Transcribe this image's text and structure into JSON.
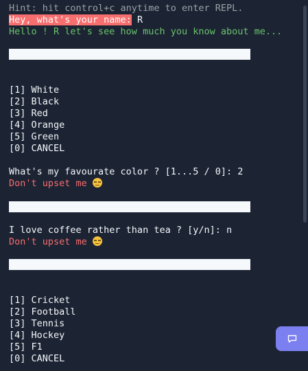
{
  "console": {
    "hint": "Hint: hit control+c anytime to enter REPL.",
    "name_prompt": "Hey, what's your name:",
    "name_value": " R",
    "greeting": "Hello ! R let's see how much you know about me...",
    "color_options": [
      "[1] White",
      "[2] Black",
      "[3] Red",
      "[4] Orange",
      "[5] Green",
      "[0] CANCEL"
    ],
    "color_question": "What's my favourate color ? [1...5 / 0]: 2",
    "color_feedback": "Don't upset me ",
    "coffee_question": "I love coffee rather than tea ? [y/n]: n",
    "coffee_feedback": "Don't upset me ",
    "sport_options": [
      "[1] Cricket",
      "[2] Football",
      "[3] Tennis",
      "[4] Hockey",
      "[5] F1",
      "[0] CANCEL"
    ]
  },
  "icons": {
    "feedback_emoji": "disappointed-face-icon",
    "chat": "chat-bubble-icon"
  },
  "colors": {
    "background": "#1c2333",
    "prompt_highlight": "#f76e6e",
    "green_text": "#6bc46d",
    "red_text": "#f76e6e",
    "chat_button": "#7b7ff0"
  }
}
